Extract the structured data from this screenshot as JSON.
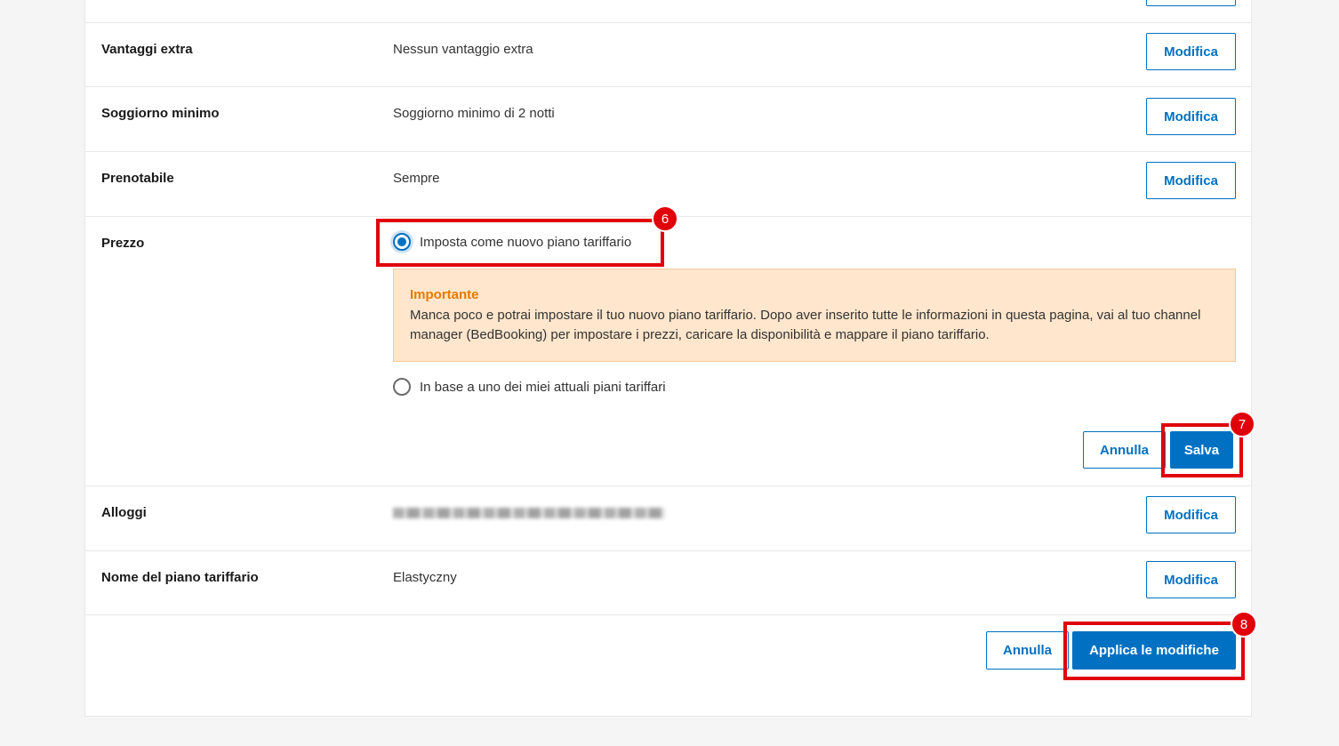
{
  "rows": [
    {
      "label": "Vantaggi extra",
      "value": "Nessun vantaggio extra",
      "action": "Modifica"
    },
    {
      "label": "Soggiorno minimo",
      "value": "Soggiorno minimo di 2 notti",
      "action": "Modifica"
    },
    {
      "label": "Prenotabile",
      "value": "Sempre",
      "action": "Modifica"
    }
  ],
  "price": {
    "label": "Prezzo",
    "option_new": "Imposta come nuovo piano tariffario",
    "option_existing": "In base a uno dei miei attuali piani tariffari",
    "selected": "option_new",
    "alert_title": "Importante",
    "alert_text": "Manca poco e potrai impostare il tuo nuovo piano tariffario. Dopo aver inserito tutte le informazioni in questa pagina, vai al tuo channel manager (BedBooking) per impostare i prezzi, caricare la disponibilità e mappare il piano tariffario.",
    "cancel": "Annulla",
    "save": "Salva"
  },
  "accommodations": {
    "label": "Alloggi",
    "action": "Modifica"
  },
  "plan_name": {
    "label": "Nome del piano tariffario",
    "value": "Elastyczny",
    "action": "Modifica"
  },
  "footer": {
    "cancel": "Annulla",
    "apply": "Applica le modifiche"
  },
  "annotations": {
    "step6": "6",
    "step7": "7",
    "step8": "8"
  },
  "colors": {
    "accent": "#0071c2",
    "highlight": "#e0000a",
    "alert_bg": "#ffe6cc",
    "alert_title": "#e47a00"
  }
}
